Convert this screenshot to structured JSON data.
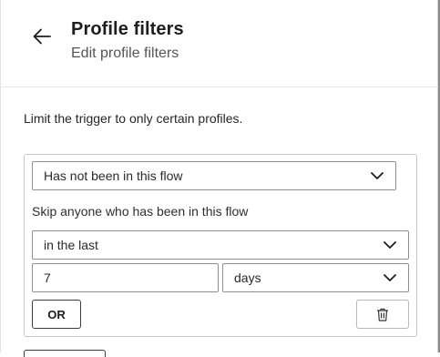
{
  "header": {
    "title": "Profile filters",
    "subtitle": "Edit profile filters"
  },
  "description": "Limit the trigger to only certain profiles.",
  "filter": {
    "condition_select": "Has not been in this flow",
    "helper_text": "Skip anyone who has been in this flow",
    "timeframe_select": "in the last",
    "amount_value": "7",
    "unit_select": "days",
    "or_label": "OR"
  },
  "icons": {
    "back": "arrow-left-icon",
    "chevron": "chevron-down-icon",
    "trash": "trash-icon"
  }
}
